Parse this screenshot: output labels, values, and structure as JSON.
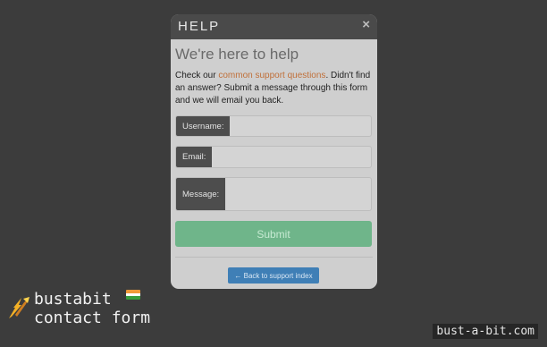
{
  "modal": {
    "title": "HELP",
    "close_glyph": "×",
    "heading": "We're here to help",
    "intro_before_link": "Check our ",
    "intro_link": "common support questions",
    "intro_after_link": ". Didn't find an answer? Submit a message through this form and we will email you back.",
    "fields": {
      "username_label": "Username:",
      "username_value": "",
      "email_label": "Email:",
      "email_value": "",
      "message_label": "Message:",
      "message_value": ""
    },
    "submit_label": "Submit",
    "back_label": "← Back to support index"
  },
  "brand": {
    "line1": "bustabit",
    "line2": "contact form",
    "icon": "rocket-bolt-icon",
    "flag": "india-flag-icon"
  },
  "watermark": "bust-a-bit.com",
  "colors": {
    "background": "#3c3c3c",
    "modal_bg": "#cfcfcf",
    "header_bg": "#4a4a4a",
    "link": "#c0703a",
    "submit": "#6fb58a",
    "back_button": "#3f7fb6"
  }
}
